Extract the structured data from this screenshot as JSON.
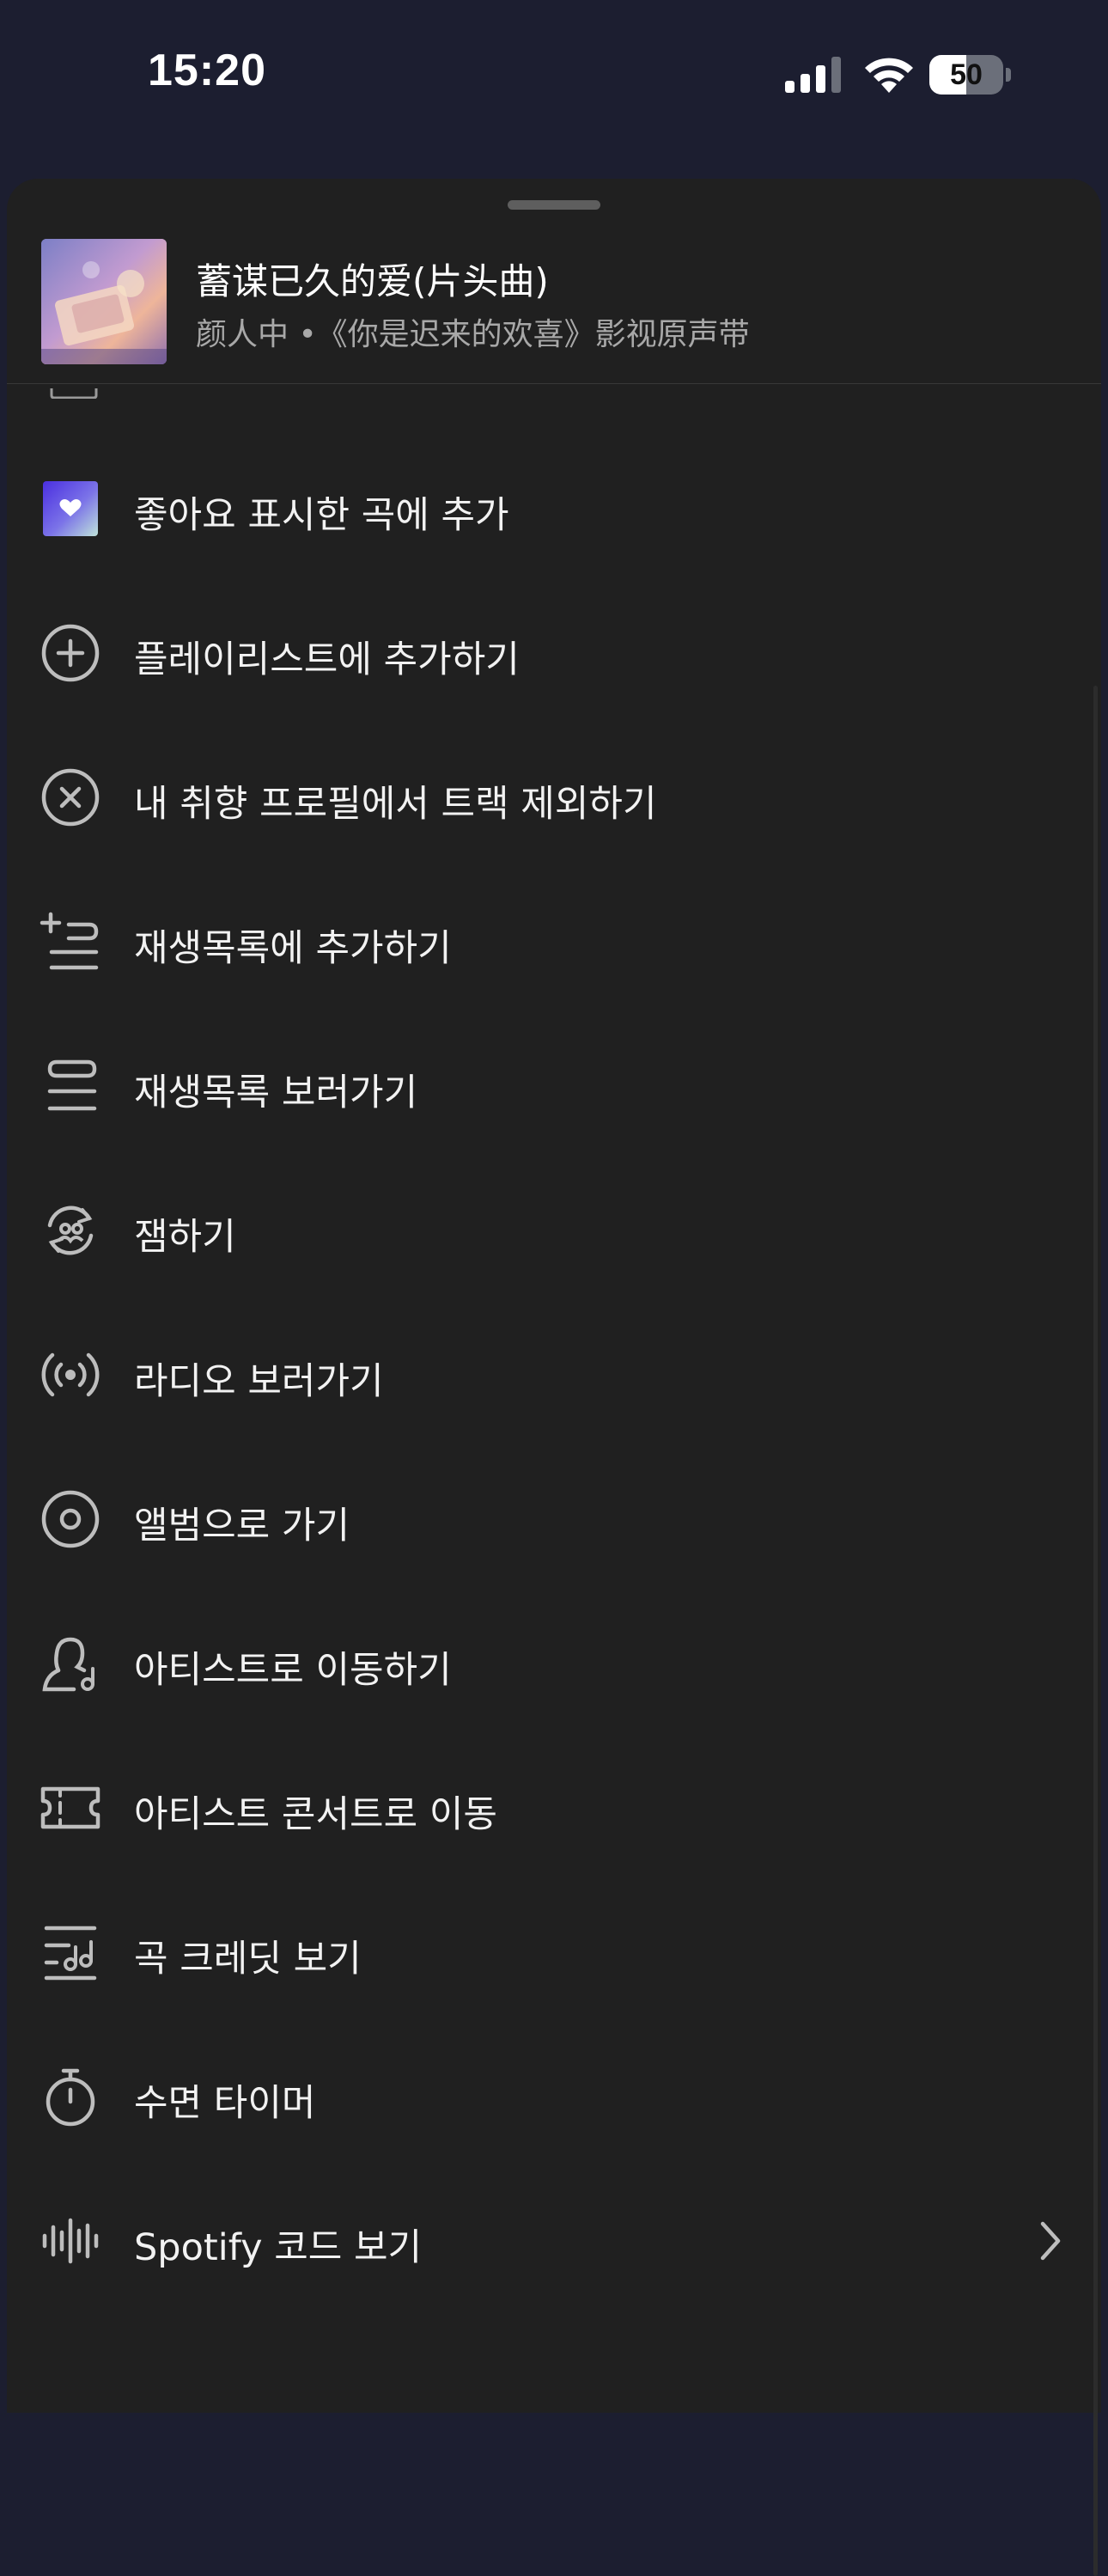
{
  "status_bar": {
    "time": "15:20",
    "battery_percent": 50
  },
  "track": {
    "title": "蓄谋已久的爱(片头曲)",
    "subtitle": "颜人中 •《你是迟来的欢喜》影视原声带",
    "artwork_colors": [
      "#8a84c8",
      "#e6a79a",
      "#f0c48e"
    ]
  },
  "menu": {
    "items": [
      {
        "label": "좋아요 표시한 곡에 추가",
        "icon": "liked-songs-icon"
      },
      {
        "label": "플레이리스트에 추가하기",
        "icon": "plus-circle-icon"
      },
      {
        "label": "내 취향 프로필에서 트랙 제외하기",
        "icon": "x-circle-icon"
      },
      {
        "label": "재생목록에 추가하기",
        "icon": "add-to-queue-icon"
      },
      {
        "label": "재생목록 보러가기",
        "icon": "queue-icon"
      },
      {
        "label": "잼하기",
        "icon": "jam-icon"
      },
      {
        "label": "라디오 보러가기",
        "icon": "radio-icon"
      },
      {
        "label": "앨범으로 가기",
        "icon": "album-icon"
      },
      {
        "label": "아티스트로 이동하기",
        "icon": "artist-icon"
      },
      {
        "label": "아티스트 콘서트로 이동",
        "icon": "ticket-icon"
      },
      {
        "label": "곡 크레딧 보기",
        "icon": "credits-icon"
      },
      {
        "label": "수면 타이머",
        "icon": "timer-icon"
      },
      {
        "label": "Spotify 코드 보기",
        "icon": "spotify-code-icon"
      }
    ]
  },
  "colors": {
    "sheet_background": "#202020",
    "top_background": "#1c1e30",
    "subtitle_text": "#a8a8a8",
    "liked_gradient_start": "#4a2fe0",
    "liked_gradient_end": "#bfe3da"
  }
}
